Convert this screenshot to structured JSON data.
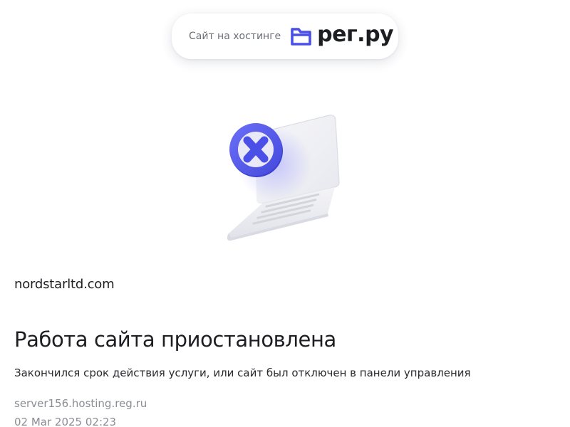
{
  "header": {
    "badge_text": "Сайт на хостинге",
    "brand_name": "рег.ру",
    "brand_color": "#4a4fe8"
  },
  "main": {
    "illustration_icon": "laptop-with-error-icon",
    "domain": "nordstarltd.com",
    "title": "Работа сайта приостановлена",
    "description": "Закончился срок действия услуги, или сайт был отключен в панели управления",
    "server": "server156.hosting.reg.ru",
    "datetime": "02 Mar 2025 02:23"
  }
}
